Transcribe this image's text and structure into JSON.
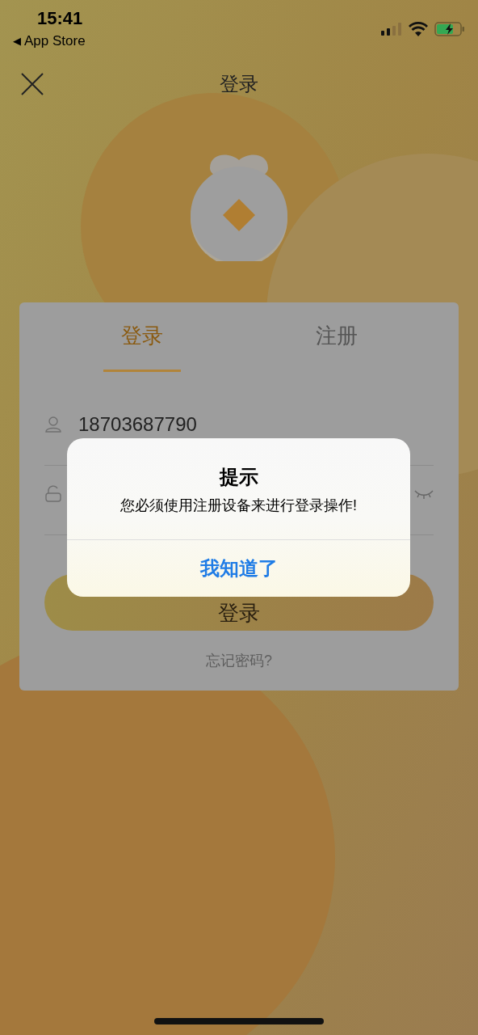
{
  "status_bar": {
    "time": "15:41",
    "back_arrow": "◀",
    "back_label": "App Store"
  },
  "nav": {
    "title": "登录"
  },
  "tabs": [
    {
      "label": "登录",
      "selected": true
    },
    {
      "label": "注册",
      "selected": false
    }
  ],
  "fields": [
    {
      "kind": "account",
      "value": "18703687790"
    },
    {
      "kind": "password"
    }
  ],
  "login_button": "登录",
  "forgot_link": "忘记密码?",
  "alert": {
    "title": "提示",
    "message": "您必须使用注册设备来进行登录操作!",
    "button": "我知道了"
  }
}
